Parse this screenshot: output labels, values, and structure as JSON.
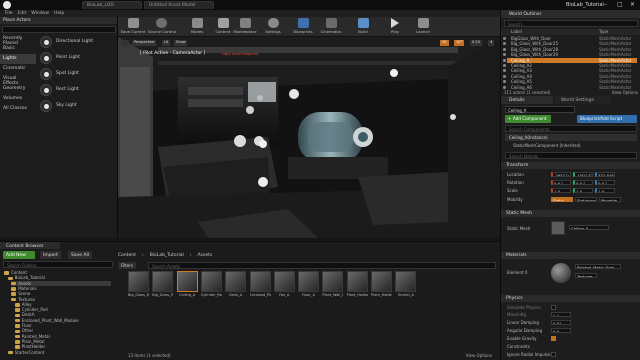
{
  "window": {
    "tabs": [
      "BioLab_LOD",
      "Untitled Asset Model"
    ],
    "project_title": "BioLab_Tutorial",
    "controls": {
      "minimize": "–",
      "maximize": "□",
      "close": "✕"
    }
  },
  "menu": [
    "File",
    "Edit",
    "Window",
    "Help"
  ],
  "toolbar": {
    "buttons": [
      "Save Current",
      "Source Control",
      "Modes",
      "Content",
      "Marketplace",
      "Settings",
      "Blueprints",
      "Cinematics",
      "Build",
      "Play",
      "Launch"
    ]
  },
  "place_actors": {
    "tab_title": "Place Actors",
    "categories": [
      "Recently Placed",
      "Basic",
      "Lights",
      "Cinematic",
      "Visual Effects",
      "Geometry",
      "Volumes",
      "All Classes"
    ],
    "selected_category": "Lights",
    "items": [
      "Directional Light",
      "Point Light",
      "Spot Light",
      "Rect Light",
      "Sky Light"
    ]
  },
  "viewport": {
    "buttons": [
      "Perspective",
      "Lit",
      "Show"
    ],
    "pilot_text": "[ Pilot Active - CameraActor ]",
    "pilot_subtext": "Light Build Required",
    "grid_value": "10",
    "angle_value": "10°",
    "scale_value": "0.25",
    "camera_speed": "4"
  },
  "world_outliner": {
    "title": "World Outliner",
    "search_placeholder": "Search...",
    "col_label": "Label",
    "col_type": "Type",
    "rows": [
      {
        "label": "BigGlass_With_Door",
        "type": "StaticMeshActor"
      },
      {
        "label": "Big_Glass_With_Door25",
        "type": "StaticMeshActor"
      },
      {
        "label": "Big_Glass_With_Door28",
        "type": "StaticMeshActor"
      },
      {
        "label": "Big_Glass_With_Door29",
        "type": "StaticMeshActor"
      },
      {
        "label": "Ceiling_A",
        "type": "StaticMeshActor"
      },
      {
        "label": "Ceiling_A2",
        "type": "StaticMeshActor"
      },
      {
        "label": "Ceiling_A3",
        "type": "StaticMeshActor"
      },
      {
        "label": "Ceiling_A4",
        "type": "StaticMeshActor"
      },
      {
        "label": "Ceiling_A5",
        "type": "StaticMeshActor"
      },
      {
        "label": "Ceiling_A6",
        "type": "StaticMeshActor"
      }
    ],
    "selected_row": "Ceiling_A",
    "footer": "111 actors (1 selected)",
    "view_options": "View Options"
  },
  "details": {
    "tabs": [
      "Details",
      "World Settings"
    ],
    "actor_name": "Ceiling_A",
    "add_component": "+ Add Component",
    "blueprint_button": "Blueprint/Add Script",
    "search_placeholder": "Search Components",
    "components": [
      "Ceiling_A(Instance)",
      "StaticMeshComponent (Inherited)"
    ],
    "search_details_placeholder": "Search Details",
    "transform_header": "Transform",
    "location_label": "Location",
    "location": [
      "-2957.0",
      "-1507.52",
      "332.979"
    ],
    "rotation_label": "Rotation",
    "rotation": [
      "0.0 °",
      "0.0 °",
      "0.0 °"
    ],
    "scale_label": "Scale",
    "scale": [
      "1.0",
      "1.0",
      "1.0"
    ],
    "mobility_label": "Mobility",
    "mobility_options": [
      "Static",
      "Stationary",
      "Movable"
    ],
    "static_mesh_header": "Static Mesh",
    "static_mesh_label": "Static Mesh",
    "static_mesh_value": "Ceiling_A",
    "materials_header": "Materials",
    "element_label": "Element 0",
    "material_value": "Painted_Metal_Dark",
    "textures_value": "Textures",
    "physics_header": "Physics",
    "simulate_physics": "Simulate Physics",
    "mass_label": "MassInKg",
    "mass_value": "0.0",
    "linear_damping": "Linear Damping",
    "linear_damping_value": "0.01",
    "angular_damping": "Angular Damping",
    "angular_damping_value": "0.0",
    "enable_gravity": "Enable Gravity",
    "constraints": "Constraints",
    "ignore_radial": "Ignore Radial Impulse"
  },
  "content_browser": {
    "title": "Content Browser",
    "add_new": "Add New",
    "import": "Import",
    "save_all": "Save All",
    "breadcrumb": [
      "Content",
      "BioLab_Tutorial",
      "Assets"
    ],
    "filters": "Filters",
    "search_placeholder": "Search Assets",
    "search_paths_placeholder": "Search Folders",
    "tree": [
      "Content",
      "BioLab_Tutorial",
      "Assets",
      "Materials",
      "Scene",
      "Textures",
      "Alley",
      "Cylinder_Pod",
      "DeskA",
      "Enclosed_Plant_Wall_Module",
      "Floor",
      "Other",
      "Painted_Metal",
      "Plain_Metal",
      "PlantHolder",
      "StarterContent"
    ],
    "selected_tree": "Assets",
    "assets": [
      "Big_Glass_Window_A",
      "Big_Glass_With_Door",
      "Ceiling_A",
      "Cylinder_Pod",
      "Desk_A",
      "Enclosed_Plant_Wall_Module",
      "Fan_A",
      "Floor_A",
      "Plant_Wall_Plate",
      "Plant_Holder_A",
      "Plant_Holder_B",
      "Screen_A"
    ],
    "footer": "13 items (1 selected)",
    "view_options": "View Options"
  },
  "colors": {
    "accent_orange": "#cf7a28",
    "add_green": "#3f8a2e",
    "blueprint_blue": "#2f6fb0",
    "panel_bg": "#1d1d1d"
  }
}
